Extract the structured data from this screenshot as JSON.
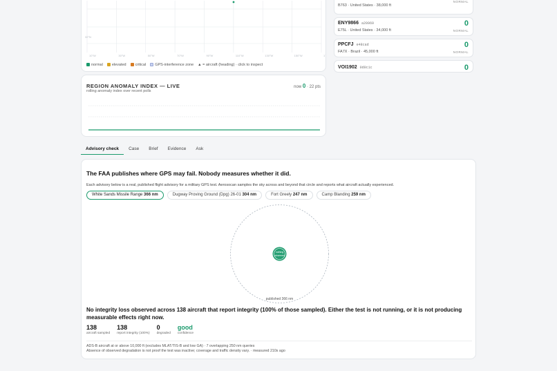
{
  "map": {
    "lat_labels": [
      "",
      "32°N"
    ],
    "lon_labels": [
      "10°W",
      "30°W",
      "50°W",
      "70°W",
      "90°W",
      "110°W",
      "130°W",
      "150°W",
      "170°W"
    ],
    "legend": [
      {
        "label": "normal",
        "color": "#1a9a6c"
      },
      {
        "label": "elevated",
        "color": "#d9a520"
      },
      {
        "label": "critical",
        "color": "#d77a21"
      },
      {
        "label": "GPS-interference zone",
        "color": "#c9d3f0"
      },
      {
        "label": "▲ = aircraft (heading) · click to inspect",
        "color": ""
      }
    ]
  },
  "anomaly": {
    "title": "REGION ANOMALY INDEX — LIVE",
    "subtitle": "rolling anomaly index over recent polls",
    "now_label": "now",
    "now_value": "0",
    "pts_label": "· 22 pts",
    "series_color": "#1a9a6c",
    "index_values": [
      0,
      0,
      0,
      0,
      0,
      0,
      0,
      0,
      0,
      0,
      0,
      0,
      0,
      0,
      0,
      0,
      0,
      0,
      0,
      0,
      0,
      0
    ]
  },
  "flights": [
    {
      "callsign": "",
      "hex": "",
      "meta": "B763 · United States · 38,000 ft",
      "score": "",
      "state": "NORMAL"
    },
    {
      "callsign": "ENY9866",
      "hex": "a20969",
      "meta": "E75L · United States · 34,000 ft",
      "score": "0",
      "state": "NORMAL"
    },
    {
      "callsign": "PPCFJ",
      "hex": "e48cad",
      "meta": "FA7X · Brazil · 45,000 ft",
      "score": "0",
      "state": "NORMAL"
    },
    {
      "callsign": "VOI1902",
      "hex": "0d0c1c",
      "meta": "",
      "score": "0",
      "state": "NORMAL"
    }
  ],
  "tabs": [
    "Advisory check",
    "Case",
    "Brief",
    "Evidence",
    "Ask"
  ],
  "advisory": {
    "title": "The FAA publishes where GPS may fail. Nobody measures whether it did.",
    "description": "Each advisory below is a real, published flight advisory for a military GPS test. Aerosocan samples the sky across and beyond that circle and reports what aircraft actually experienced.",
    "pills": [
      {
        "name": "White Sands Missile Range",
        "dist": "366 nm",
        "selected": true
      },
      {
        "name": "Dugway Proving Ground (Dpg) 26-01",
        "dist": "304 nm",
        "selected": false
      },
      {
        "name": "Fort Greely",
        "dist": "247 nm",
        "selected": false
      },
      {
        "name": "Camp Blanding",
        "dist": "259 nm",
        "selected": false
      }
    ],
    "ring_center_label_1": "nothing",
    "ring_center_label_2": "observed",
    "ring_radius_label": "published 366 nm",
    "verdict": "No integrity loss observed across 138 aircraft that report integrity (100% of those sampled). Either the test is not running, or it is not producing measurable effects right now.",
    "stats": [
      {
        "value": "138",
        "label": "aircraft sampled",
        "green": false
      },
      {
        "value": "138",
        "label": "report integrity (100%)",
        "green": false
      },
      {
        "value": "0",
        "label": "degraded",
        "green": false
      },
      {
        "value": "good",
        "label": "confidence",
        "green": true
      }
    ],
    "footnote_1": "ADS-B aircraft at or above 10,000 ft (excludes MLAT/TIS-B and low GA) · 7 overlapping 250 nm queries",
    "footnote_2": "Absence of observed degradation is not proof the test was inactive; coverage and traffic density vary. · measured 210s ago"
  }
}
